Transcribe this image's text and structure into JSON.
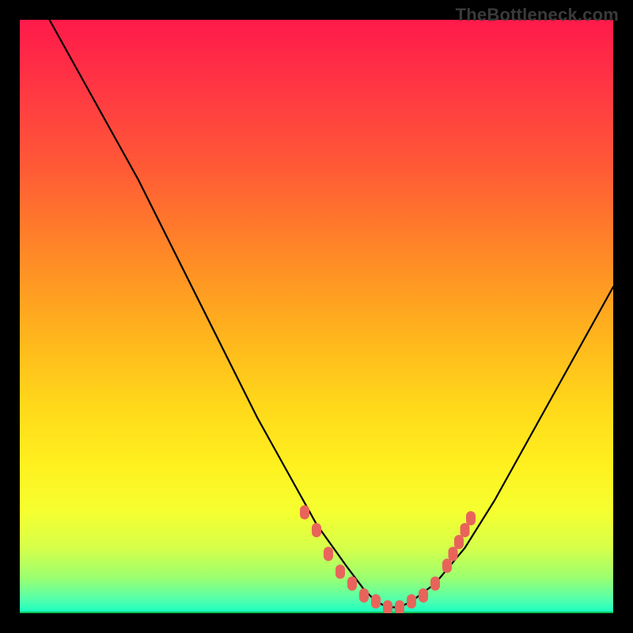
{
  "watermark": "TheBottleneck.com",
  "chart_data": {
    "type": "line",
    "title": "",
    "xlabel": "",
    "ylabel": "",
    "xlim": [
      0,
      100
    ],
    "ylim": [
      0,
      100
    ],
    "series": [
      {
        "name": "curve",
        "x": [
          5,
          10,
          15,
          20,
          25,
          30,
          35,
          40,
          45,
          50,
          55,
          58,
          60,
          62,
          64,
          66,
          70,
          75,
          80,
          85,
          90,
          95,
          100
        ],
        "y": [
          100,
          91,
          82,
          73,
          63,
          53,
          43,
          33,
          24,
          15,
          8,
          4,
          2,
          1,
          1,
          2,
          5,
          11,
          19,
          28,
          37,
          46,
          55
        ]
      }
    ],
    "markers": {
      "name": "highlighted-points",
      "x": [
        48,
        50,
        52,
        54,
        56,
        58,
        60,
        62,
        64,
        66,
        68,
        70,
        72,
        73,
        74,
        75,
        76
      ],
      "y": [
        17,
        14,
        10,
        7,
        5,
        3,
        2,
        1,
        1,
        2,
        3,
        5,
        8,
        10,
        12,
        14,
        16
      ]
    },
    "gradient": {
      "top_color": "#ff1a4a",
      "bottom_color": "#12ffc2"
    }
  }
}
